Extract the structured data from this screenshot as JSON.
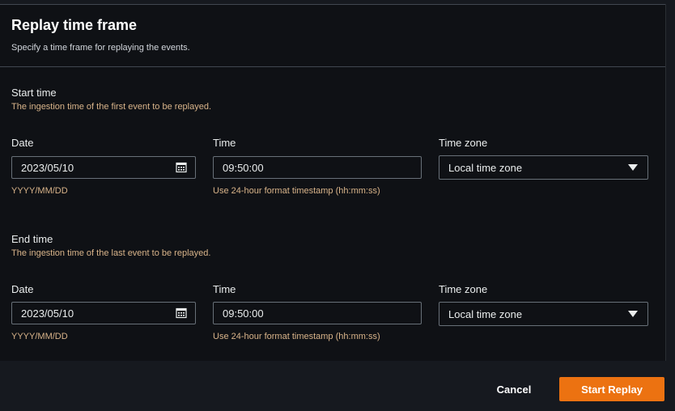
{
  "header": {
    "title": "Replay time frame",
    "subtitle": "Specify a time frame for replaying the events."
  },
  "start": {
    "title": "Start time",
    "description": "The ingestion time of the first event to be replayed.",
    "date_label": "Date",
    "date_value": "2023/05/10",
    "date_hint": "YYYY/MM/DD",
    "time_label": "Time",
    "time_value": "09:50:00",
    "time_hint": "Use 24-hour format timestamp (hh:mm:ss)",
    "tz_label": "Time zone",
    "tz_value": "Local time zone"
  },
  "end": {
    "title": "End time",
    "description": "The ingestion time of the last event to be replayed.",
    "date_label": "Date",
    "date_value": "2023/05/10",
    "date_hint": "YYYY/MM/DD",
    "time_label": "Time",
    "time_value": "09:50:00",
    "time_hint": "Use 24-hour format timestamp (hh:mm:ss)",
    "tz_label": "Time zone",
    "tz_value": "Local time zone"
  },
  "footer": {
    "cancel_label": "Cancel",
    "submit_label": "Start Replay"
  },
  "colors": {
    "accent": "#ec7211",
    "panel": "#0f1115",
    "hint": "#d9b48a"
  },
  "icons": {
    "date_picker": "calendar-icon",
    "dropdown": "caret-down-icon"
  }
}
